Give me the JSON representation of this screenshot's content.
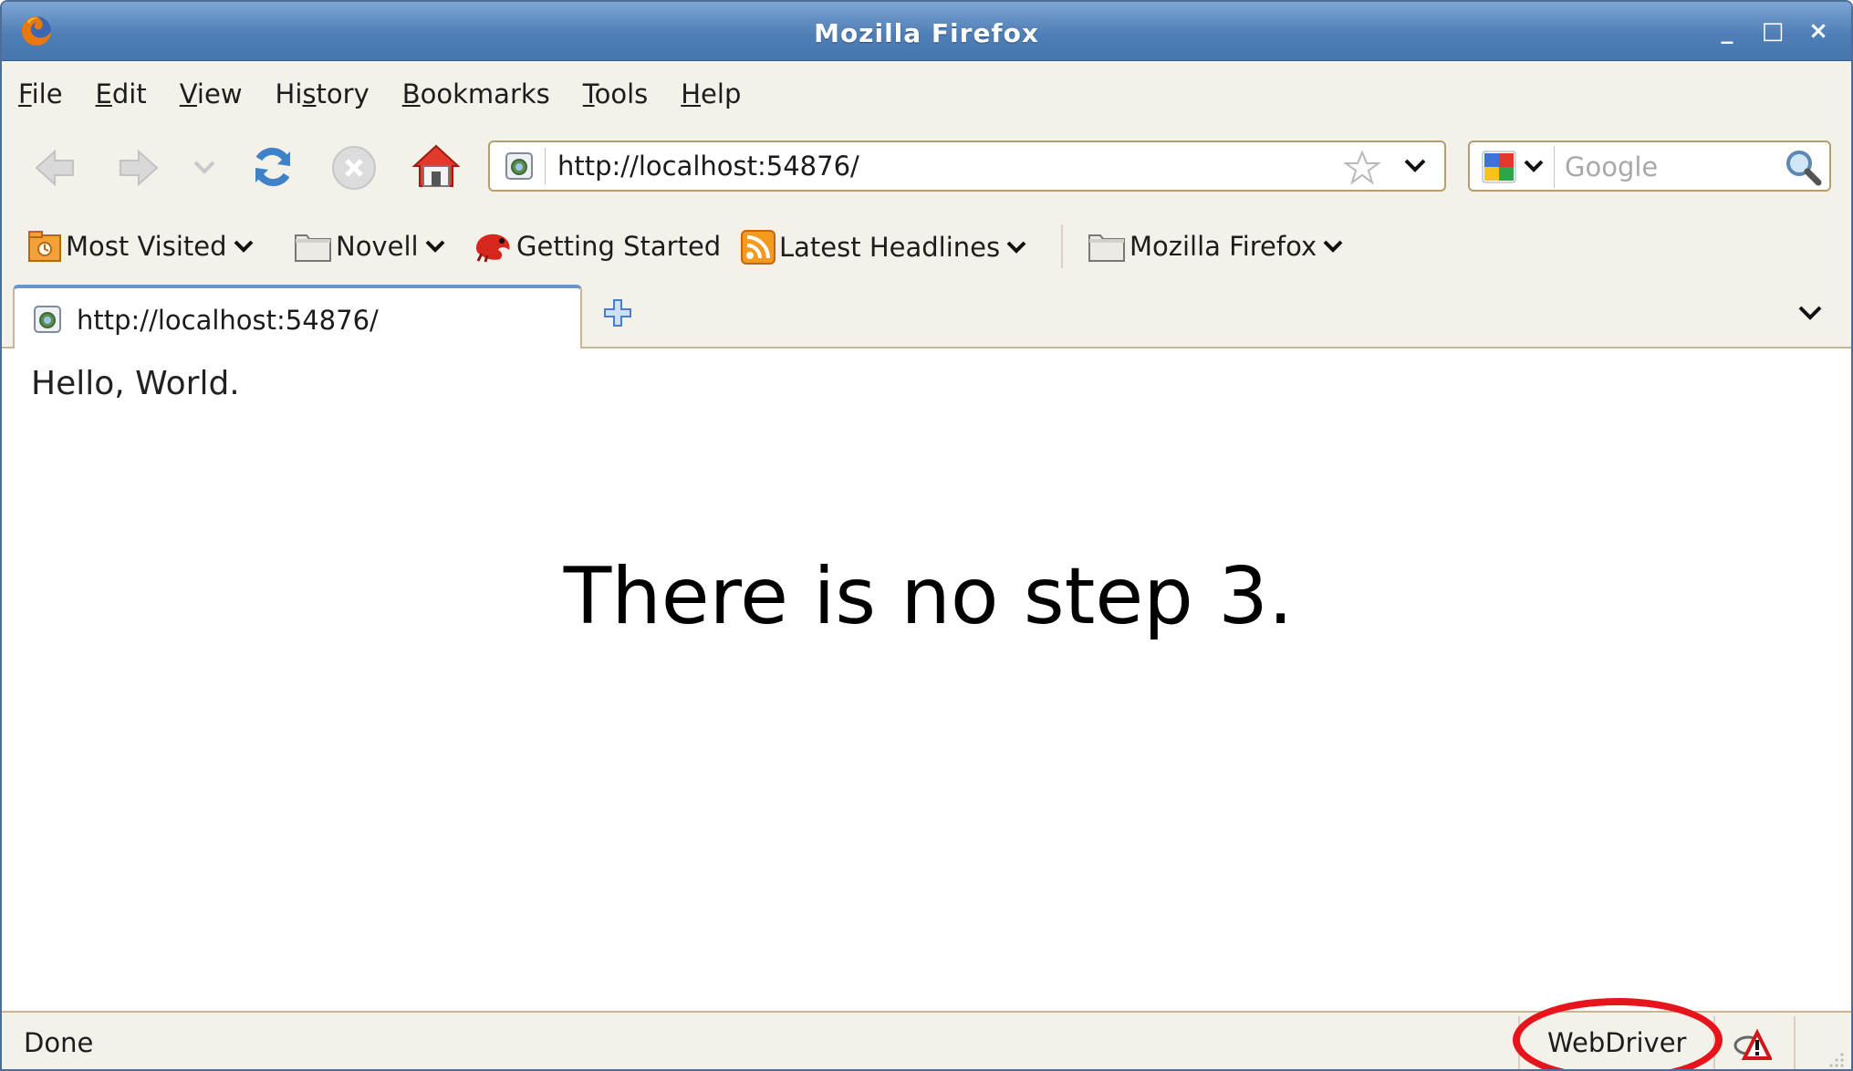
{
  "window": {
    "title": "Mozilla Firefox",
    "controls": [
      "_",
      "□",
      "×"
    ]
  },
  "menu": [
    {
      "label": "File",
      "accel": "F",
      "rest": "ile",
      "pre": ""
    },
    {
      "label": "Edit",
      "accel": "E",
      "rest": "dit",
      "pre": ""
    },
    {
      "label": "View",
      "accel": "V",
      "rest": "iew",
      "pre": ""
    },
    {
      "label": "History",
      "accel": "s",
      "rest": "tory",
      "pre": "Hi"
    },
    {
      "label": "Bookmarks",
      "accel": "B",
      "rest": "ookmarks",
      "pre": ""
    },
    {
      "label": "Tools",
      "accel": "T",
      "rest": "ools",
      "pre": ""
    },
    {
      "label": "Help",
      "accel": "H",
      "rest": "elp",
      "pre": ""
    }
  ],
  "navigation": {
    "url": "http://localhost:54876/",
    "search_placeholder": "Google"
  },
  "bookmarks": [
    {
      "label": "Most Visited",
      "icon": "most-visited-icon",
      "menu": true
    },
    {
      "label": "Novell",
      "icon": "folder-icon",
      "menu": true
    },
    {
      "label": "Getting Started",
      "icon": "opensuse-chameleon-icon",
      "menu": false
    },
    {
      "label": "Latest Headlines",
      "icon": "rss-feed-icon",
      "menu": true
    },
    {
      "label": "Mozilla Firefox",
      "icon": "folder-icon",
      "menu": true
    }
  ],
  "tabs": [
    {
      "label": "http://localhost:54876/",
      "active": true
    }
  ],
  "content": {
    "page_text": "Hello, World.",
    "caption": "There is no step 3."
  },
  "status": {
    "text": "Done",
    "webdriver_label": "WebDriver"
  },
  "colors": {
    "titlebar": "#4f7fb6",
    "highlight": "#e8141c",
    "accent_tab": "#6b95c8"
  }
}
